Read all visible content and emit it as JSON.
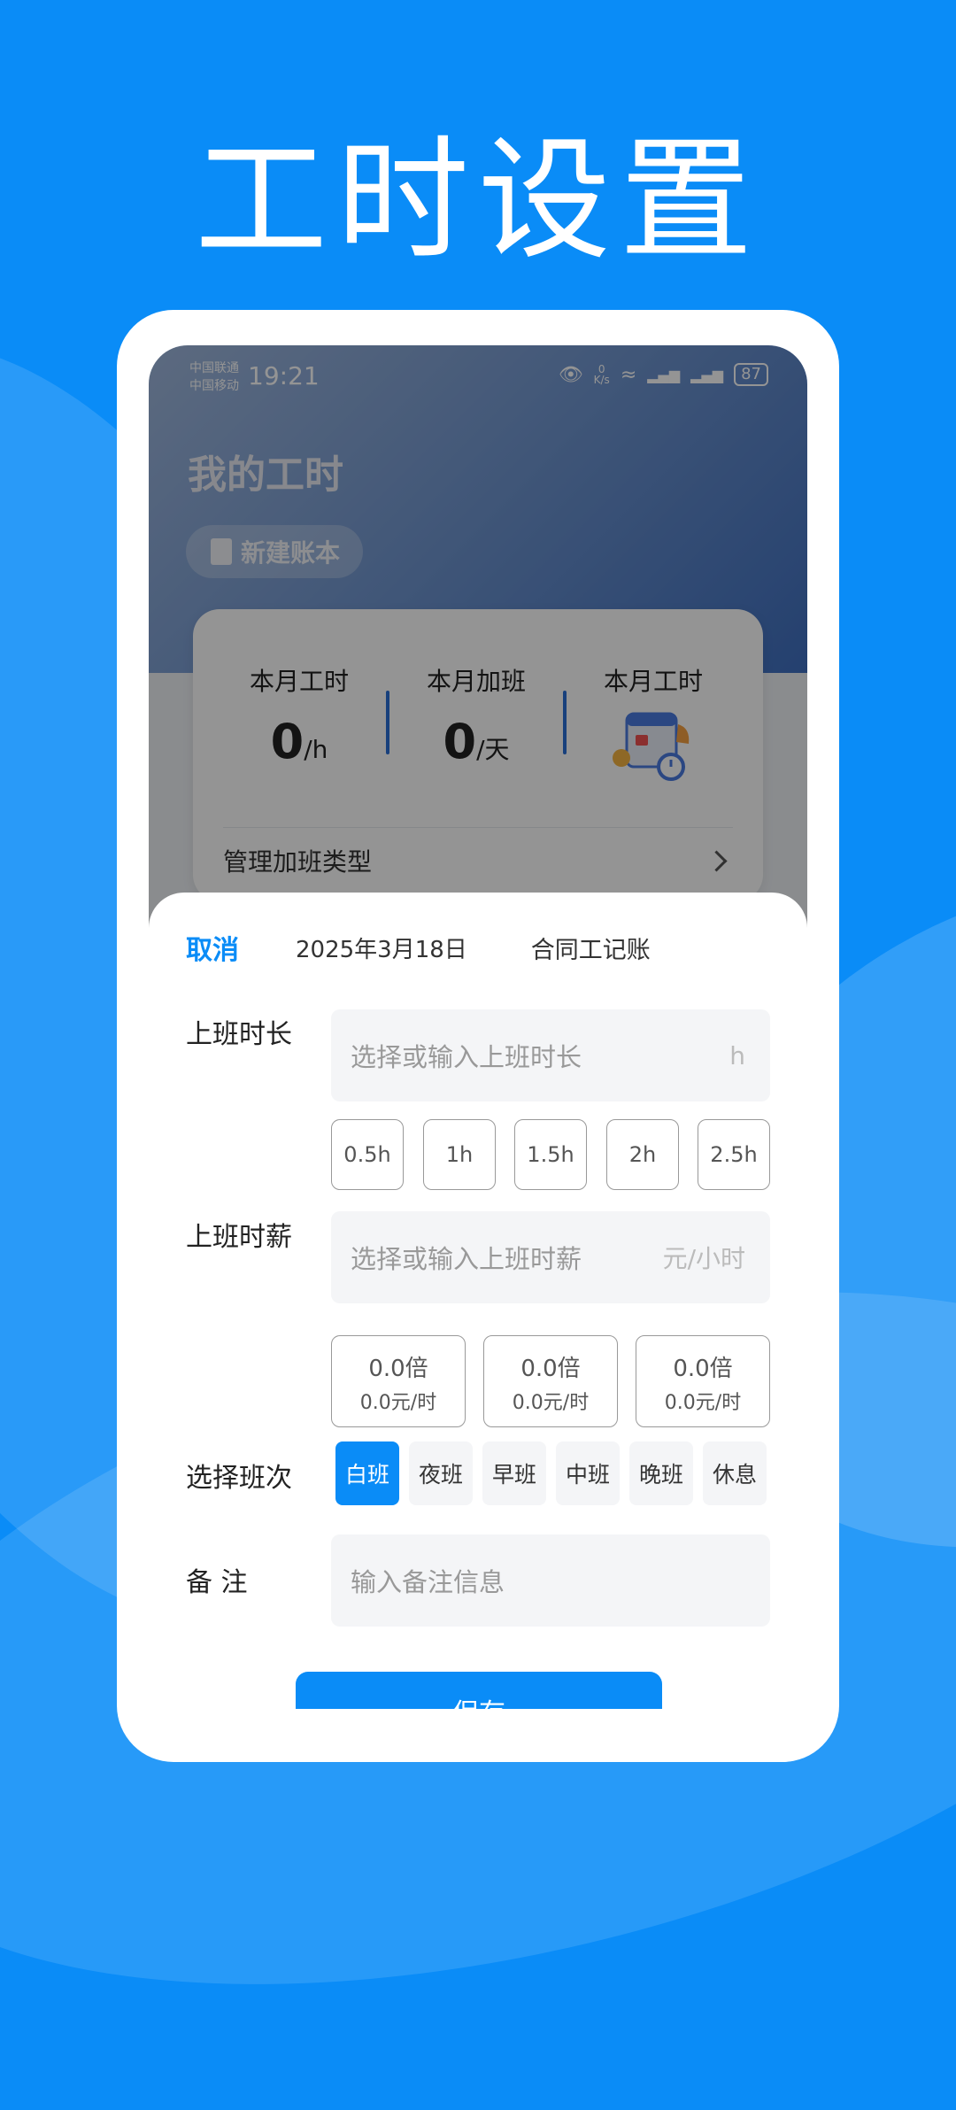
{
  "hero": {
    "title": "工时设置"
  },
  "statusbar": {
    "carrier1": "中国联通",
    "carrier2": "中国移动",
    "time": "19:21",
    "net_speed_value": "0",
    "net_speed_unit": "K/s",
    "battery": "87"
  },
  "app": {
    "title": "我的工时",
    "new_book": "新建账本",
    "stats": [
      {
        "label": "本月工时",
        "value": "0",
        "unit": "/h"
      },
      {
        "label": "本月加班",
        "value": "0",
        "unit": "/天"
      },
      {
        "label": "本月工时"
      }
    ],
    "manage": "管理加班类型"
  },
  "sheet": {
    "cancel": "取消",
    "date": "2025年3月18日",
    "mode": "合同工记账",
    "work_hours_label": "上班时长",
    "work_hours_placeholder": "选择或输入上班时长",
    "work_hours_suffix": "h",
    "hour_chips": [
      "0.5h",
      "1h",
      "1.5h",
      "2h",
      "2.5h"
    ],
    "wage_label": "上班时薪",
    "wage_placeholder": "选择或输入上班时薪",
    "wage_suffix": "元/小时",
    "multipliers": [
      {
        "a": "0.0倍",
        "b": "0.0元/时"
      },
      {
        "a": "0.0倍",
        "b": "0.0元/时"
      },
      {
        "a": "0.0倍",
        "b": "0.0元/时"
      }
    ],
    "shift_label": "选择班次",
    "shifts": [
      "白班",
      "夜班",
      "早班",
      "中班",
      "晚班",
      "休息"
    ],
    "note_label": "备 注",
    "note_placeholder": "输入备注信息",
    "save": "保存"
  },
  "colors": {
    "accent": "#0a8cf7",
    "background": "#0a8cf7"
  }
}
